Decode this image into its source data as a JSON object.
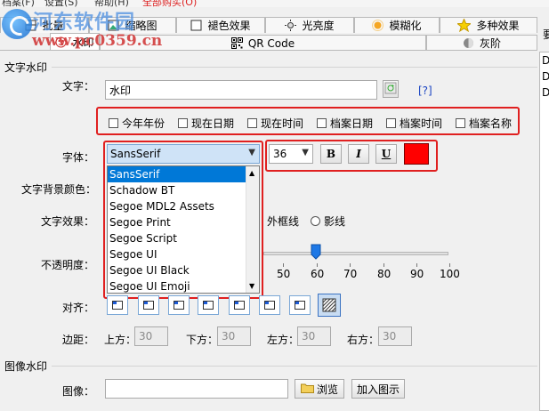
{
  "menubar": {
    "items": [
      "档案(F)",
      "设置(S)",
      "帮助(H)"
    ],
    "extra": "全部购买(O)",
    "accent": "#dd2222"
  },
  "watermark": {
    "cn": "河东软件园",
    "url": "www.pc0359.cn"
  },
  "tabs": {
    "row1": [
      {
        "label": "批量",
        "icon": "grid-icon"
      },
      {
        "label": "缩略图",
        "icon": "image-icon"
      },
      {
        "label": "褪色效果",
        "icon": "square-icon"
      },
      {
        "label": "光亮度",
        "icon": "sun-icon"
      },
      {
        "label": "模糊化",
        "icon": "blur-icon"
      },
      {
        "label": "多种效果",
        "icon": "star-icon"
      }
    ],
    "row2": [
      {
        "label": "水印",
        "icon": "watermark-icon",
        "active": true
      },
      {
        "label": "QR Code",
        "icon": "qrcode-icon"
      },
      {
        "label": "灰阶",
        "icon": "gray-icon"
      }
    ]
  },
  "right_panel": {
    "header": "要",
    "items": [
      "D",
      "D",
      "D"
    ]
  },
  "text_watermark": {
    "group_title": "文字水印",
    "text_label": "文字：",
    "text_value": "水印",
    "help": "[?]",
    "insert_options": [
      "今年年份",
      "现在日期",
      "现在时间",
      "档案日期",
      "档案时间",
      "档案名称"
    ],
    "font_label": "字体：",
    "font_value": "SansSerif",
    "font_list": [
      "SansSerif",
      "Schadow BT",
      "Segoe MDL2 Assets",
      "Segoe Print",
      "Segoe Script",
      "Segoe UI",
      "Segoe UI Black",
      "Segoe UI Emoji"
    ],
    "size_value": "36",
    "bold": "B",
    "italic": "I",
    "underline": "U",
    "color": "#ff0000",
    "bg_color_label": "文字背景颜色：",
    "effect_label": "文字效果：",
    "effect_options": [
      "外框线",
      "影线"
    ],
    "opacity_label": "不透明度：",
    "opacity_ticks": [
      "50",
      "60",
      "70",
      "80",
      "90",
      "100"
    ],
    "opacity_value": 60,
    "align_label": "对齐：",
    "margin_label": "边距：",
    "margins": [
      {
        "label": "上方：",
        "value": "30"
      },
      {
        "label": "下方：",
        "value": "30"
      },
      {
        "label": "左方：",
        "value": "30"
      },
      {
        "label": "右方：",
        "value": "30"
      }
    ]
  },
  "image_watermark": {
    "group_title": "图像水印",
    "image_label": "图像：",
    "image_value": "",
    "browse": "浏览",
    "add": "加入图示"
  }
}
